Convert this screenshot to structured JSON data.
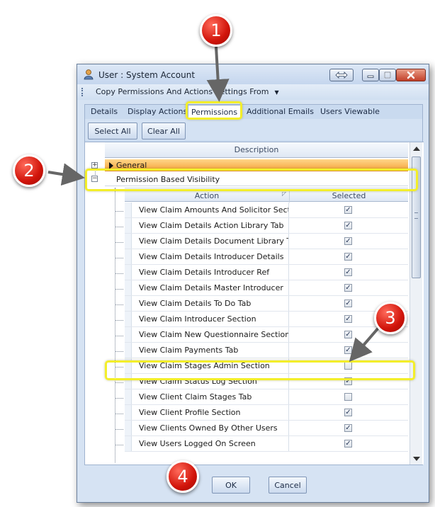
{
  "window": {
    "title": "User : System Account"
  },
  "toolbar": {
    "copy_menu_label": "Copy Permissions And Actions Settings From"
  },
  "tabs": [
    {
      "label": "Details",
      "active": false
    },
    {
      "label": "Display Actions",
      "active": false
    },
    {
      "label": "Permissions",
      "active": true
    },
    {
      "label": "Additional Emails",
      "active": false
    },
    {
      "label": "Users Viewable",
      "active": false
    }
  ],
  "buttons": {
    "select_all": "Select All",
    "clear_all": "Clear All",
    "ok": "OK",
    "cancel": "Cancel"
  },
  "grid": {
    "description_header": "Description",
    "groups": [
      {
        "label": "General",
        "expanded": false,
        "expander": "+"
      },
      {
        "label": "Permission Based Visibility",
        "expanded": true,
        "expander": "−"
      }
    ],
    "columns": {
      "action": "Action",
      "selected": "Selected"
    },
    "rows": [
      {
        "action": "View Claim Amounts And Solicitor Section",
        "selected": true
      },
      {
        "action": "View Claim Details Action Library Tab",
        "selected": true
      },
      {
        "action": "View Claim Details Document Library Tab",
        "selected": true
      },
      {
        "action": "View Claim Details Introducer Details",
        "selected": true
      },
      {
        "action": "View Claim Details Introducer Ref",
        "selected": true
      },
      {
        "action": "View Claim Details Master Introducer",
        "selected": true
      },
      {
        "action": "View Claim Details To Do Tab",
        "selected": true
      },
      {
        "action": "View Claim Introducer Section",
        "selected": true
      },
      {
        "action": "View Claim New Questionnaire Section",
        "selected": true
      },
      {
        "action": "View Claim Payments Tab",
        "selected": true
      },
      {
        "action": "View Claim Stages Admin Section",
        "selected": false
      },
      {
        "action": "View Claim Status Log Section",
        "selected": true
      },
      {
        "action": "View Client Claim Stages Tab",
        "selected": false
      },
      {
        "action": "View Client Profile Section",
        "selected": true
      },
      {
        "action": "View Clients Owned By Other Users",
        "selected": true
      },
      {
        "action": "View Users Logged On Screen",
        "selected": true
      }
    ]
  },
  "annotations": {
    "badge_1": "1",
    "badge_2": "2",
    "badge_3": "3",
    "badge_4": "4"
  },
  "colors": {
    "highlight": "#f3ee2a",
    "badge_red": "#d1140a",
    "general_orange": "#f6a23a"
  },
  "icons": {
    "title_icon": "user-icon",
    "restore": "double-arrow-icon",
    "minimize": "minimize-icon",
    "maximize": "maximize-icon",
    "close": "close-icon",
    "dropdown": "caret-down-icon",
    "check": "check-icon"
  }
}
